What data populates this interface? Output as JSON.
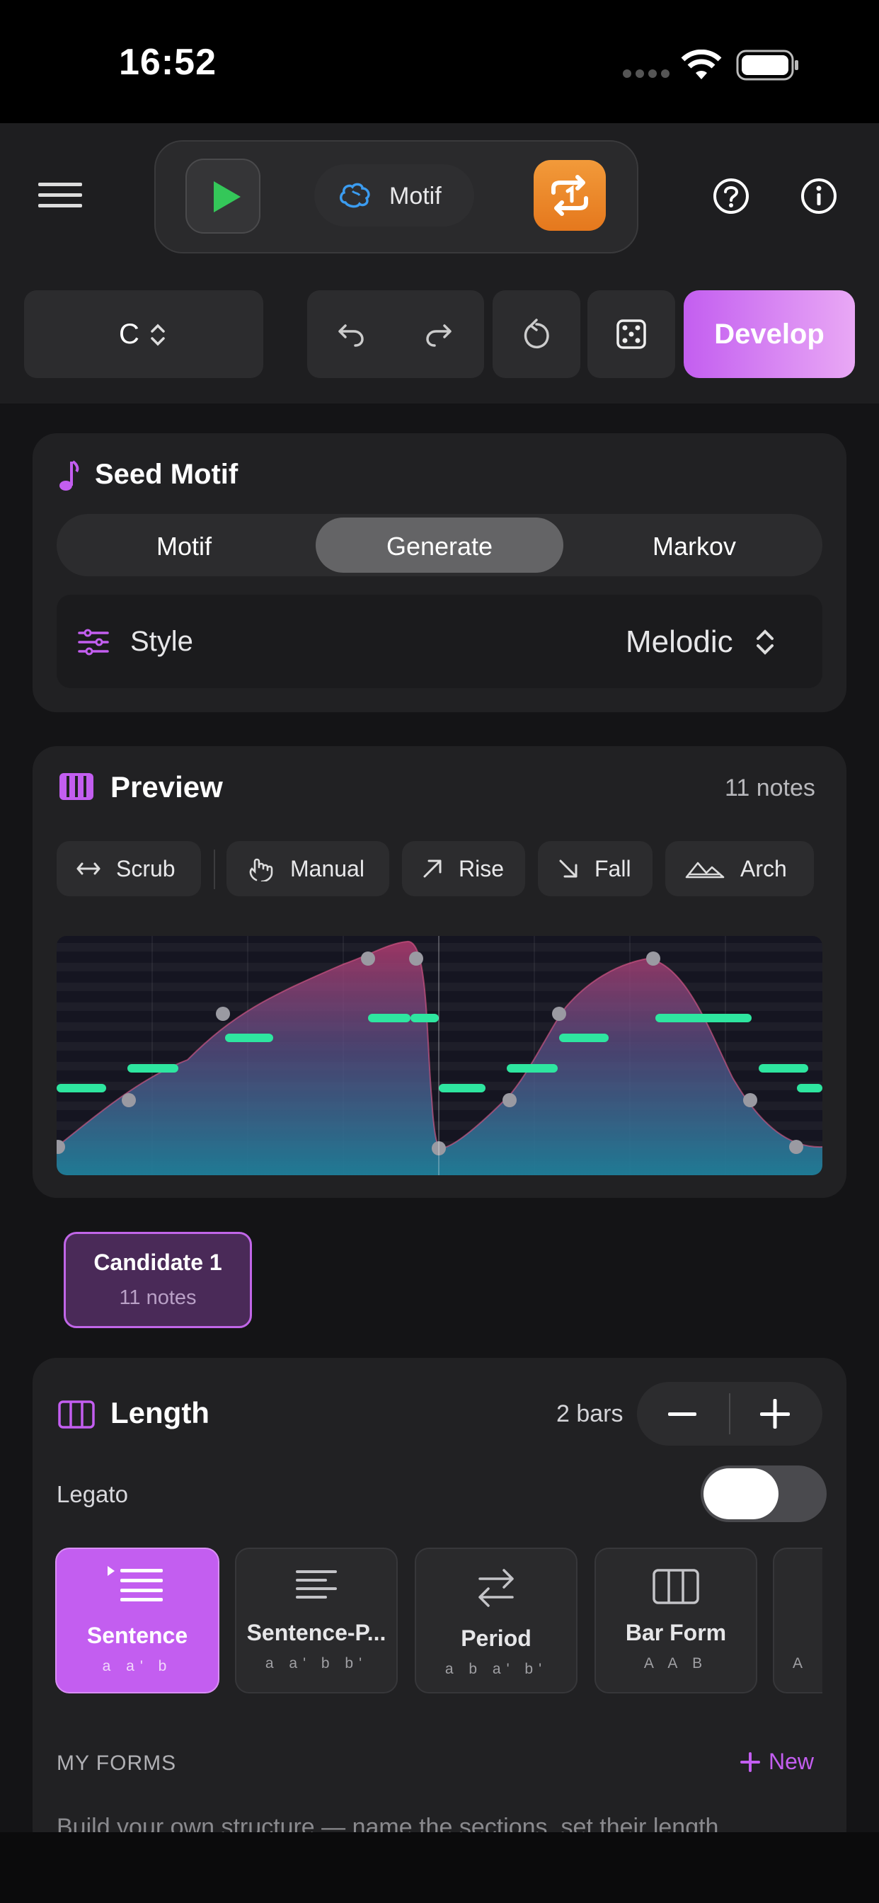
{
  "status": {
    "time": "16:52"
  },
  "header": {
    "mode_label": "Motif",
    "key_label": "C",
    "develop_label": "Develop"
  },
  "seed": {
    "title": "Seed Motif",
    "tabs": [
      "Motif",
      "Generate",
      "Markov"
    ],
    "selected_tab": "Generate",
    "style_label": "Style",
    "style_value": "Melodic"
  },
  "preview": {
    "title": "Preview",
    "count": "11 notes",
    "tools": [
      "Scrub",
      "Manual",
      "Rise",
      "Fall",
      "Arch"
    ]
  },
  "candidate": {
    "title": "Candidate 1",
    "sub": "11 notes"
  },
  "length": {
    "title": "Length",
    "bars": "2 bars",
    "legato_label": "Legato",
    "forms": [
      {
        "title": "Sentence",
        "sub": "a a' b",
        "selected": true
      },
      {
        "title": "Sentence-P...",
        "sub": "a a' b b'"
      },
      {
        "title": "Period",
        "sub": "a b a' b'"
      },
      {
        "title": "Bar Form",
        "sub": "A A B"
      },
      {
        "title": "",
        "sub": "A"
      }
    ]
  },
  "my_forms": {
    "header": "MY FORMS",
    "new_label": "New",
    "description": "Build your own structure — name the sections, set their length"
  },
  "colors": {
    "accent": "#c35ef0",
    "play": "#34c759",
    "loop": "#ee8a2a",
    "note": "#2ee6a0"
  }
}
